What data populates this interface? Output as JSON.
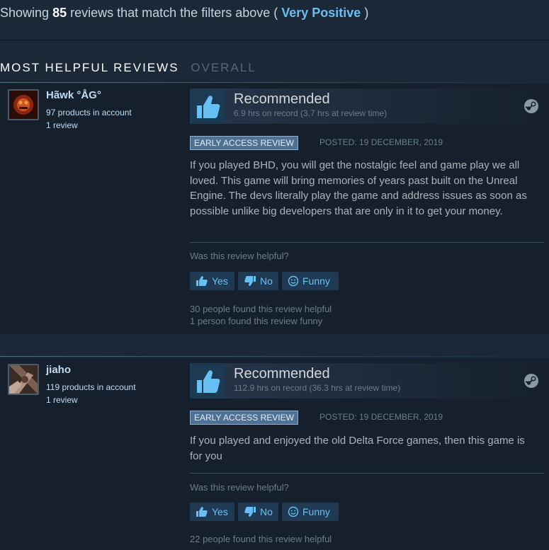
{
  "summary": {
    "prefix": "Showing",
    "count": "85",
    "middle": "reviews that match the filters above (",
    "rating": "Very Positive",
    "suffix": ")"
  },
  "tabs": {
    "most_helpful": "MOST HELPFUL REVIEWS",
    "overall": "OVERALL"
  },
  "reviews": [
    {
      "author": "Hãwk °ÅG°",
      "products": "97 products in account",
      "review_count": "1 review",
      "verdict": "Recommended",
      "hours": "6.9 hrs on record (3.7 hrs at review time)",
      "badge": "EARLY ACCESS REVIEW",
      "posted": "POSTED: 19 DECEMBER, 2019",
      "text": "If you played BHD, you will get the nostalgic feel and game play we all loved. This game will bring memories of years past built on the Unreal Engine. The devs literally play the game and address issues as soon as possible unlike big developers that are only in it to get your money.",
      "helpful_question": "Was this review helpful?",
      "yes": "Yes",
      "no": "No",
      "funny": "Funny",
      "helpful_stat": "30 people found this review helpful",
      "funny_stat": "1 person found this review funny"
    },
    {
      "author": "jiaho",
      "products": "119 products in account",
      "review_count": "1 review",
      "verdict": "Recommended",
      "hours": "112.9 hrs on record (36.3 hrs at review time)",
      "badge": "EARLY ACCESS REVIEW",
      "posted": "POSTED: 19 DECEMBER, 2019",
      "text": "If you played and enjoyed the old Delta Force games, then this game is for you",
      "helpful_question": "Was this review helpful?",
      "yes": "Yes",
      "no": "No",
      "funny": "Funny",
      "helpful_stat": "22 people found this review helpful"
    }
  ],
  "colors": {
    "background": "#1b2838",
    "review_panel": "#16202d",
    "accent_blue": "#66c0f4",
    "badge_bg": "#4f7193"
  },
  "icons": {
    "verdict": "thumbs-up-icon",
    "platform": "steam-icon",
    "vote_yes": "thumbs-up-icon",
    "vote_no": "thumbs-down-icon",
    "vote_funny": "smiley-icon"
  }
}
